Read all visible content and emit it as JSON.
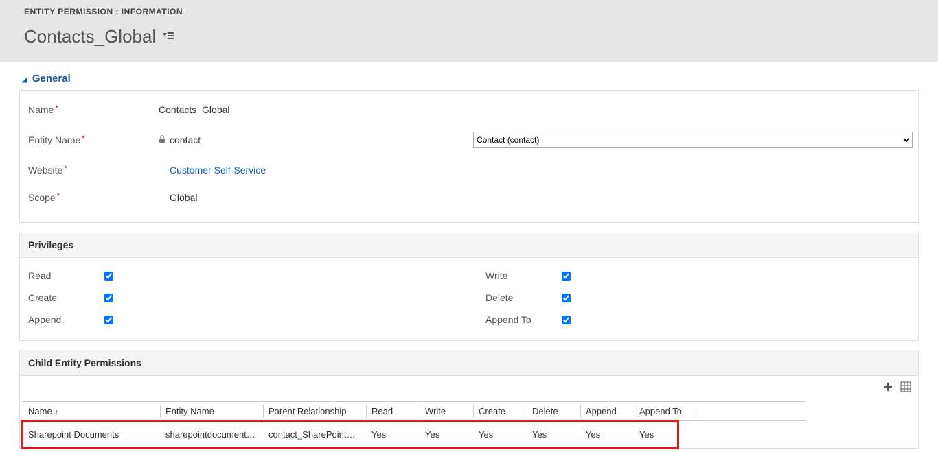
{
  "header": {
    "breadcrumb": "ENTITY PERMISSION : INFORMATION",
    "title": "Contacts_Global"
  },
  "sections": {
    "general": {
      "title": "General",
      "fields": {
        "name_label": "Name",
        "name_value": "Contacts_Global",
        "entity_label": "Entity Name",
        "entity_value": "contact",
        "entity_select_value": "Contact (contact)",
        "website_label": "Website",
        "website_value": "Customer Self-Service",
        "scope_label": "Scope",
        "scope_value": "Global"
      }
    },
    "privileges": {
      "title": "Privileges",
      "left": [
        {
          "label": "Read",
          "checked": true
        },
        {
          "label": "Create",
          "checked": true
        },
        {
          "label": "Append",
          "checked": true
        }
      ],
      "right": [
        {
          "label": "Write",
          "checked": true
        },
        {
          "label": "Delete",
          "checked": true
        },
        {
          "label": "Append To",
          "checked": true
        }
      ]
    },
    "child": {
      "title": "Child Entity Permissions",
      "columns": [
        "Name",
        "Entity Name",
        "Parent Relationship",
        "Read",
        "Write",
        "Create",
        "Delete",
        "Append",
        "Append To"
      ],
      "rows": [
        {
          "name": "Sharepoint Documents",
          "entity": "sharepointdocument…",
          "parent": "contact_SharePointD…",
          "read": "Yes",
          "write": "Yes",
          "create": "Yes",
          "delete": "Yes",
          "append": "Yes",
          "appendto": "Yes"
        }
      ]
    }
  }
}
